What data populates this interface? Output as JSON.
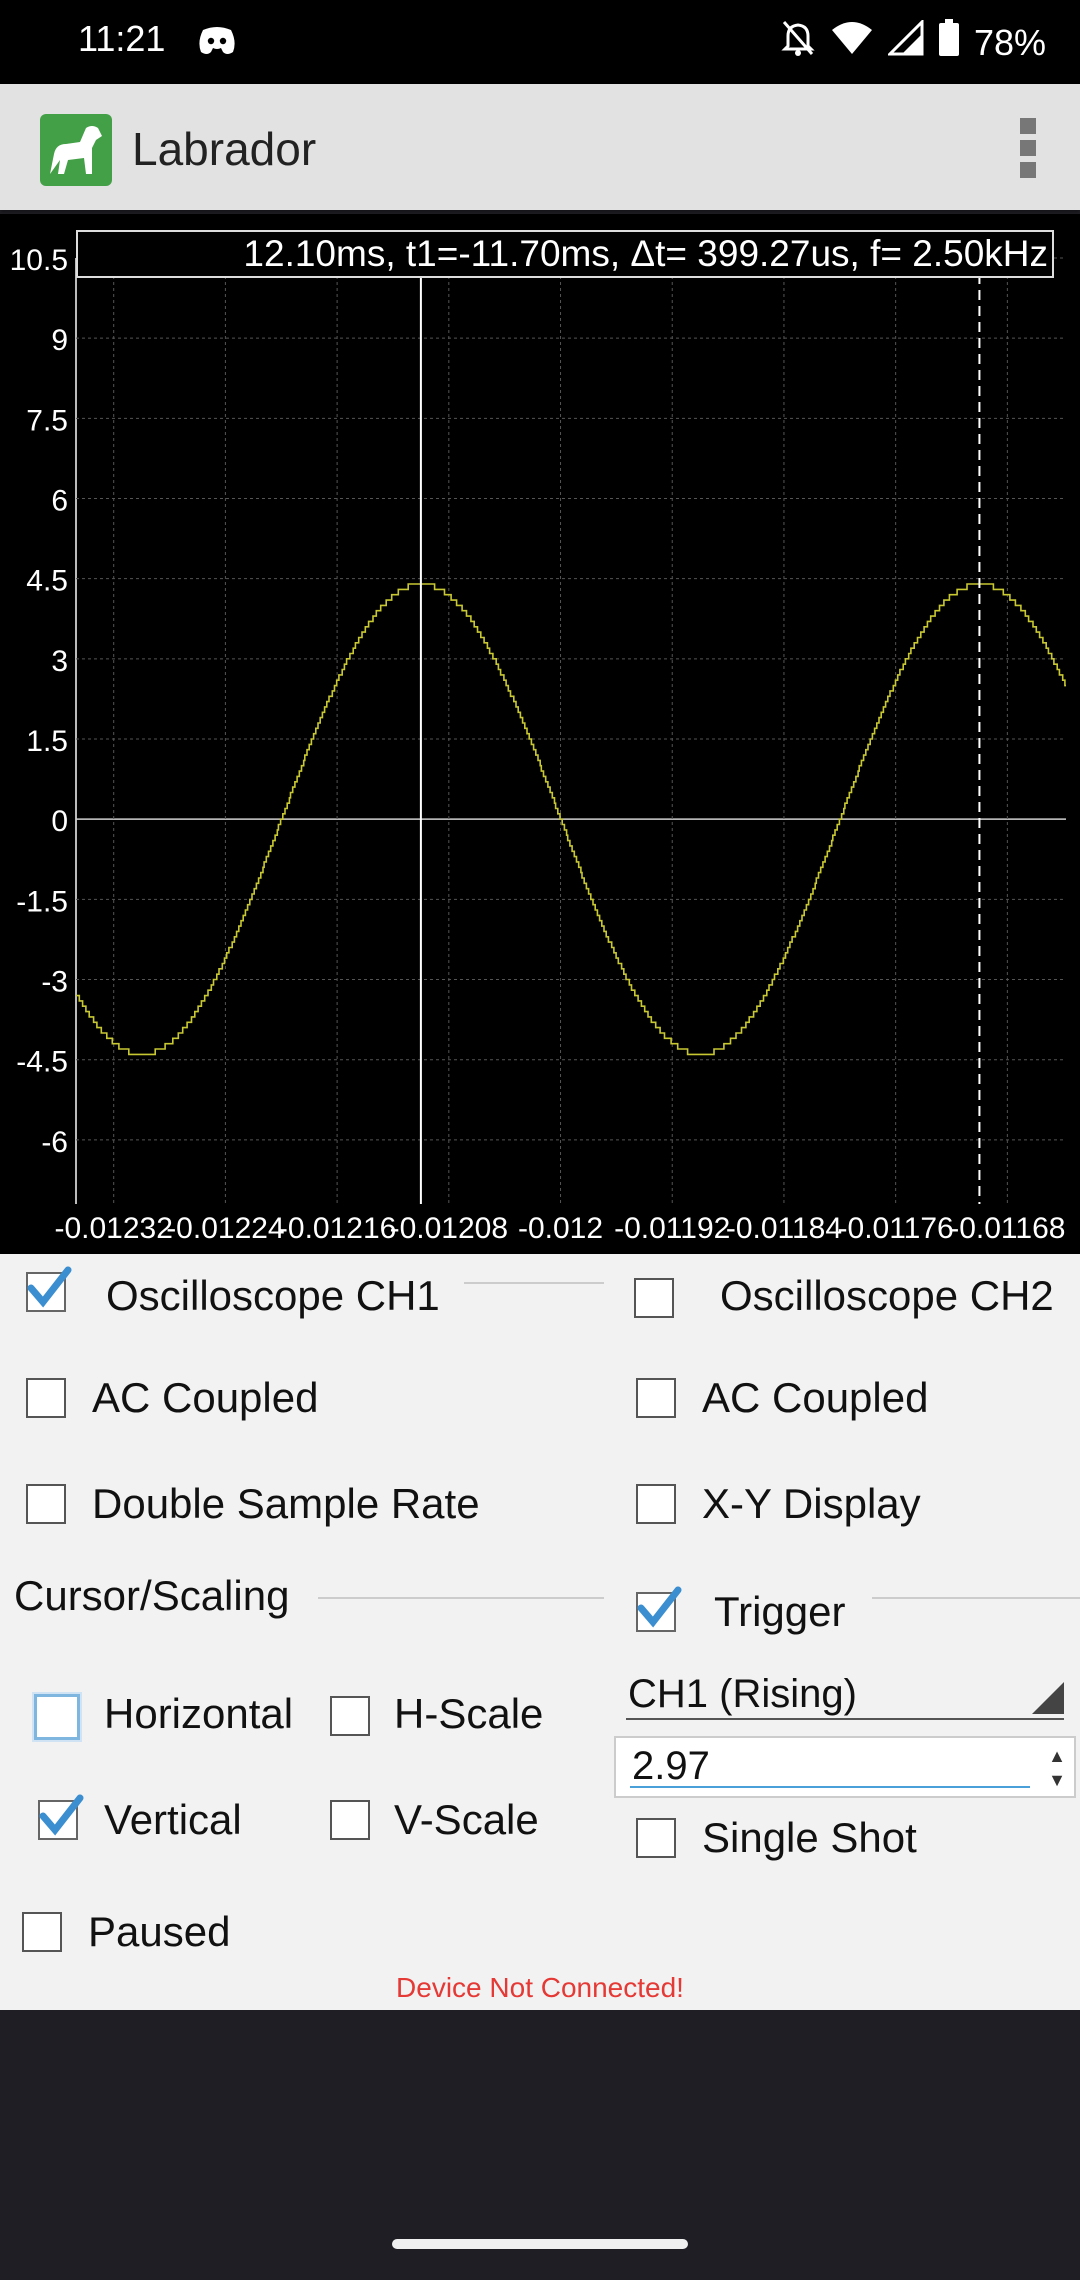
{
  "status_bar": {
    "time": "11:21",
    "battery": "78%",
    "icons": [
      "discord-icon",
      "mute-icon",
      "wifi-icon",
      "signal-icon",
      "battery-icon"
    ]
  },
  "app_bar": {
    "title": "Labrador",
    "icon": "dog-logo-icon",
    "menu_icon": "overflow-menu-icon"
  },
  "scope": {
    "cursor_readout": "12.10ms, t1=-11.70ms,  Δt= 399.27us,  f= 2.50kHz",
    "colors": {
      "background": "#000000",
      "grid": "#555555",
      "trace": "#c8c832",
      "cursor": "#ffffff"
    }
  },
  "chart_data": {
    "type": "line",
    "y_ticks": [
      "10.5",
      "9",
      "7.5",
      "6",
      "4.5",
      "3",
      "1.5",
      "0",
      "-1.5",
      "-3",
      "-4.5",
      "-6"
    ],
    "x_ticks": [
      "-0.01232",
      "-0.01224",
      "-0.01216",
      "-0.01208",
      "-0.012",
      "-0.01192",
      "-0.01184",
      "-0.01176",
      "-0.01168"
    ],
    "ylim": [
      -7.2,
      10.5
    ],
    "xlim": [
      -0.012347,
      -0.011638
    ],
    "cursors_x": [
      -0.0121,
      -0.0117
    ],
    "series": [
      {
        "amplitude": 4.4,
        "frequency_hz": 2500,
        "peak_at_x": -0.0121
      }
    ]
  },
  "controls": {
    "osc_ch1": {
      "label": "Oscilloscope CH1",
      "checked": true
    },
    "osc_ch2": {
      "label": "Oscilloscope CH2",
      "checked": false
    },
    "ac_coupled_1": {
      "label": "AC Coupled",
      "checked": false
    },
    "ac_coupled_2": {
      "label": "AC Coupled",
      "checked": false
    },
    "double_sample": {
      "label": "Double Sample Rate",
      "checked": false
    },
    "xy_display": {
      "label": "X-Y Display",
      "checked": false
    },
    "cursor_scaling": {
      "label": "Cursor/Scaling"
    },
    "trigger": {
      "label": "Trigger",
      "checked": true
    },
    "horizontal": {
      "label": "Horizontal",
      "checked": false
    },
    "h_scale": {
      "label": "H-Scale",
      "checked": false
    },
    "vertical": {
      "label": "Vertical",
      "checked": true
    },
    "v_scale": {
      "label": "V-Scale",
      "checked": false
    },
    "trigger_source": {
      "value": "CH1 (Rising)"
    },
    "trigger_level": {
      "value": "2.97"
    },
    "single_shot": {
      "label": "Single Shot",
      "checked": false
    },
    "paused": {
      "label": "Paused",
      "checked": false
    },
    "status_message": "Device Not Connected!"
  }
}
